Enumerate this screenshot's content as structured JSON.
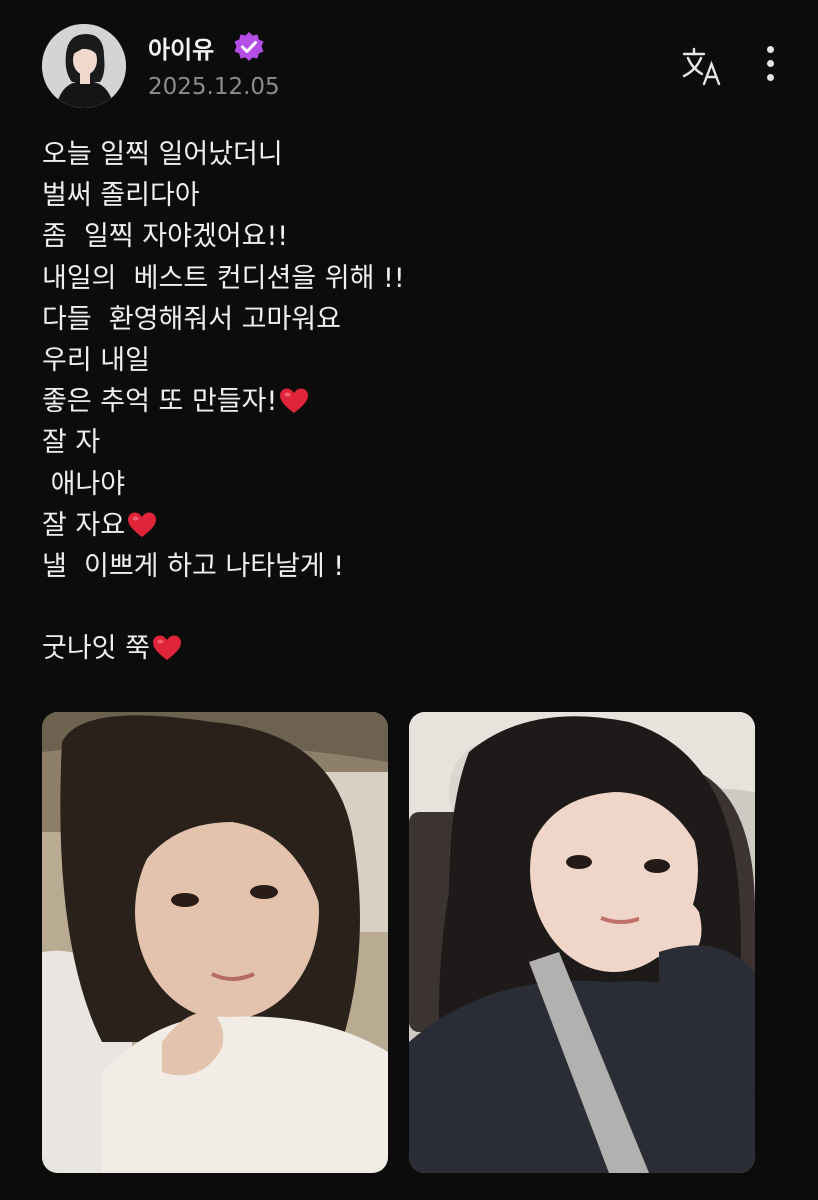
{
  "post": {
    "author": "아이유",
    "date": "2025.12.05",
    "lines": [
      "오늘 일찍 일어났더니",
      "벌써 졸리다아",
      "좀  일찍 자야겠어요!!",
      "내일의  베스트 컨디션을 위해 !!",
      "다들  환영해줘서 고마워요",
      "우리 내일",
      "좋은 추억 또 만들자!",
      "잘 자",
      " 애나야",
      "잘 자요",
      "낼  이쁘게 하고 나타날게 !",
      "",
      "굿나잇 쭉"
    ],
    "heart_lines": [
      6,
      9,
      12
    ]
  },
  "icons": {
    "verified": "verified-badge-icon",
    "translate": "translate-icon",
    "more": "more-vertical-icon",
    "heart": "red-heart-emoji"
  },
  "colors": {
    "background": "#0c0c0c",
    "text": "#efefef",
    "date": "#8c8c8c",
    "verified": "#b44ee6",
    "heart": "#e0243a"
  },
  "photos": [
    {
      "name": "photo-1"
    },
    {
      "name": "photo-2"
    }
  ]
}
